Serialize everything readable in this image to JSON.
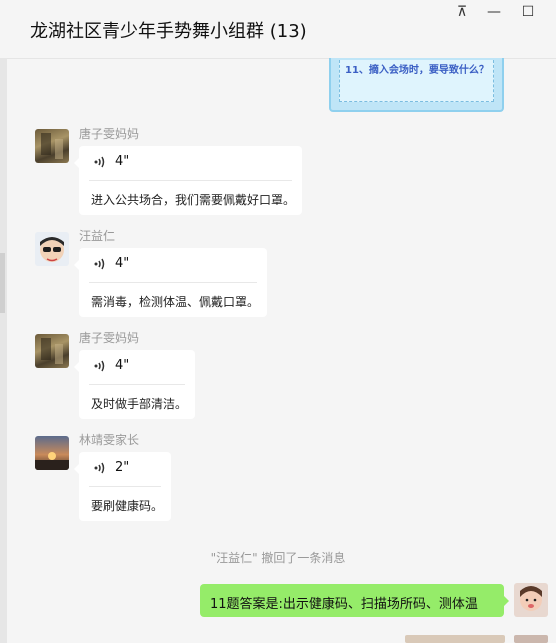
{
  "window": {
    "title": "龙湖社区青少年手势舞小组群 (13)",
    "controls": {
      "pin": "⊼",
      "minimize": "—",
      "maximize": "☐"
    }
  },
  "image_preview": {
    "text": "11、摘入会场时，要导致什么？"
  },
  "messages": [
    {
      "sender": "唐子雯妈妈",
      "duration": "4\"",
      "transcript": "进入公共场合，我们需要佩戴好口罩。"
    },
    {
      "sender": "汪益仁",
      "duration": "4\"",
      "transcript": "需消毒，检测体温、佩戴口罩。"
    },
    {
      "sender": "唐子雯妈妈",
      "duration": "4\"",
      "transcript": "及时做手部清洁。"
    },
    {
      "sender": "林靖雯家长",
      "duration": "2\"",
      "transcript": "要刷健康码。"
    }
  ],
  "recall_notice": "\"汪益仁\" 撤回了一条消息",
  "my_message": {
    "text": "11题答案是:出示健康码、扫描场所码、测体温"
  },
  "colors": {
    "my_bubble": "#95ec69",
    "background": "#f5f5f5"
  }
}
